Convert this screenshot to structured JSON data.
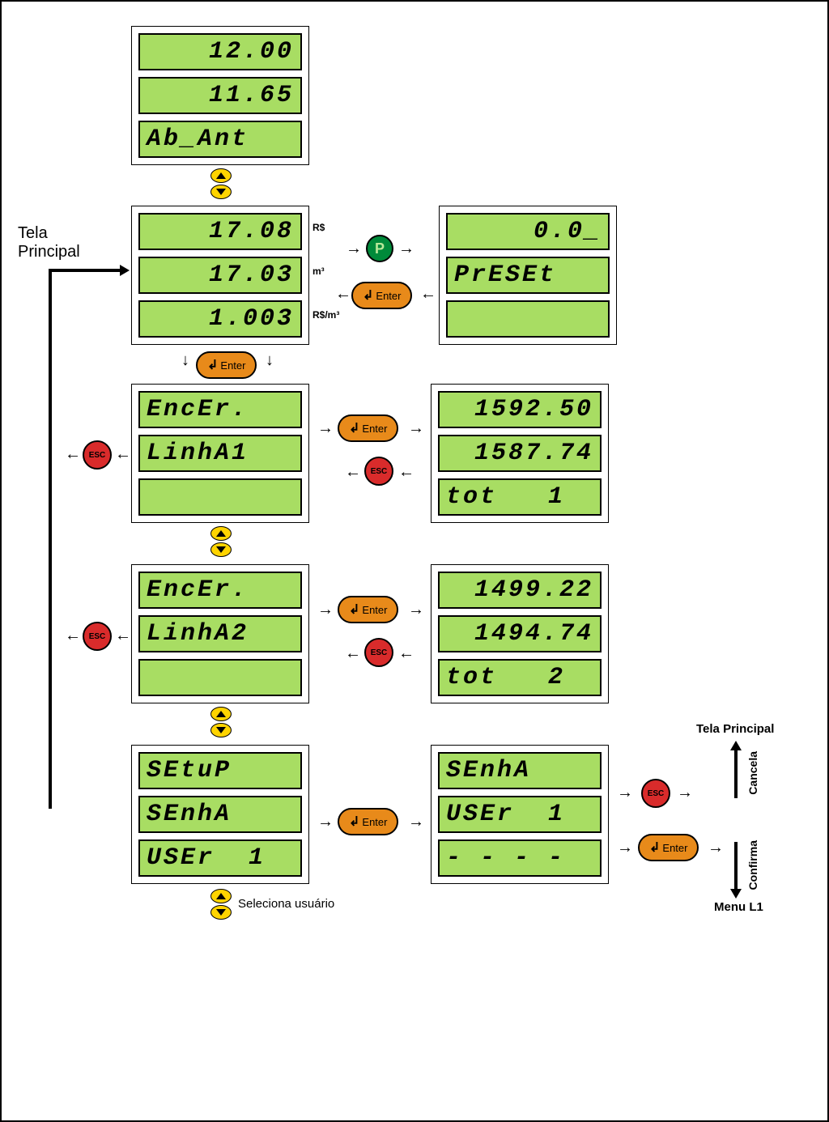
{
  "labels": {
    "tela_principal": "Tela\nPrincipal",
    "tela_principal_small": "Tela Principal",
    "seleciona_usuario": "Seleciona usuário",
    "confirma": "Confirma",
    "cancela": "Cancela",
    "menu_l1": "Menu L1",
    "enter": "Enter",
    "esc": "ESC",
    "p": "P"
  },
  "units": {
    "rs": "R$",
    "m3": "m³",
    "rs_m3": "R$/m³"
  },
  "panels": {
    "ab_ant": {
      "line1": "12.00",
      "line2": "11.65",
      "line3": "Ab_Ant"
    },
    "main": {
      "line1": "17.08",
      "line2": "17.03",
      "line3": "1.003"
    },
    "preset": {
      "line1": "0.0_",
      "line2": "PrESEt",
      "line3": ""
    },
    "encer1": {
      "line1": "EncEr.",
      "line2": "LinhA1",
      "line3": ""
    },
    "tot1": {
      "line1": "1592.50",
      "line2": "1587.74",
      "line3": "tot   1"
    },
    "encer2": {
      "line1": "EncEr.",
      "line2": "LinhA2",
      "line3": ""
    },
    "tot2": {
      "line1": "1499.22",
      "line2": "1494.74",
      "line3": "tot   2"
    },
    "setup": {
      "line1": "SEtuP",
      "line2": "SEnhA",
      "line3": "USEr  1"
    },
    "senha": {
      "line1": "SEnhA",
      "line2": "USEr  1",
      "line3": "- - - -"
    }
  }
}
